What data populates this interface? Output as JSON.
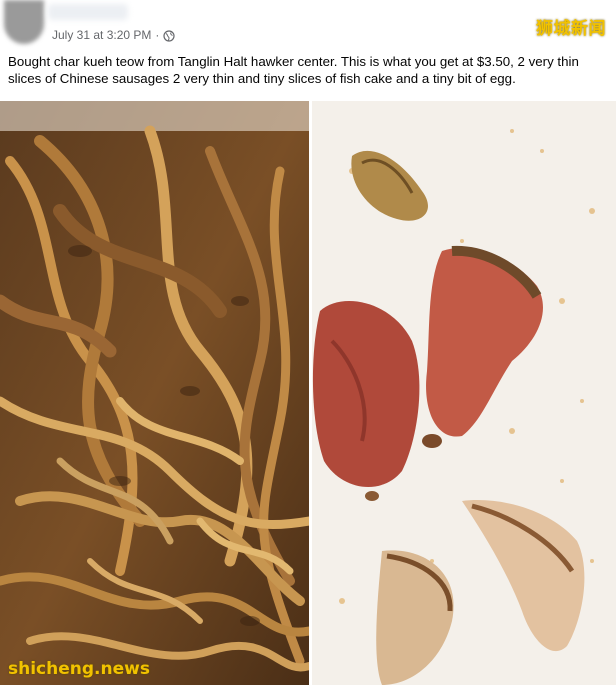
{
  "post": {
    "timestamp": "July 31 at 3:20 PM",
    "separator": "·",
    "audience_icon": "globe-icon",
    "caption": "Bought char kueh teow from Tanglin Halt hawker center. This is what you get at $3.50, 2 very thin slices of Chinese sausages 2 very thin and tiny slices of fish cake and a tiny bit of egg."
  },
  "watermarks": {
    "top_right": "狮城新闻",
    "bottom_left": "shicheng.news"
  },
  "colors": {
    "secondary_text": "#65676b",
    "watermark": "#f2c200",
    "noodle_dark": "#6b4420",
    "noodle_light": "#c9924a",
    "sausage": "#b0493a",
    "plate": "#f4f0ea"
  }
}
